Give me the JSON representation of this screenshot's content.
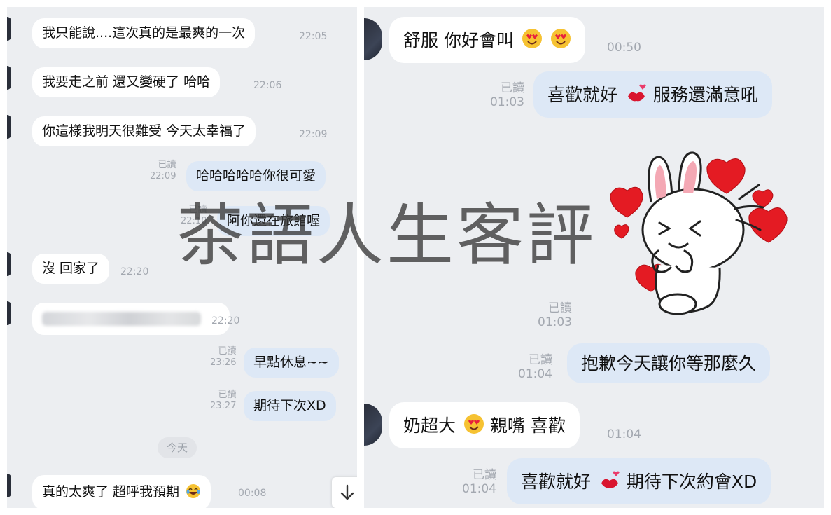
{
  "left_chat": {
    "messages": [
      {
        "text": "我只能說....這次真的是最爽的一次",
        "time": "22:05"
      },
      {
        "text": "我要走之前 還又變硬了 哈哈",
        "time": "22:06"
      },
      {
        "text": "你這樣我明天很難受 今天太幸福了",
        "time": "22:09"
      },
      {
        "text": "哈哈哈哈哈你很可愛",
        "read": "已讀",
        "time": "22:09"
      },
      {
        "text": "阿你還在旅館喔",
        "read": "已讀",
        "time": "22:10"
      },
      {
        "text": "沒 回家了",
        "time": "22:20"
      },
      {
        "text": "",
        "time": "22:20"
      },
      {
        "text": "早點休息~~",
        "read": "已讀",
        "time": "23:26"
      },
      {
        "text": "期待下次XD",
        "read": "已讀",
        "time": "23:27"
      },
      {
        "text": "真的太爽了 超呼我預期",
        "time": "00:08"
      }
    ],
    "day_separator": "今天",
    "scroll_icon": "arrow-down-icon"
  },
  "right_chat": {
    "messages": [
      {
        "text": "舒服 你好會叫",
        "time": "00:50"
      },
      {
        "text_a": "喜歡就好",
        "text_b": "服務還滿意吼",
        "read": "已讀",
        "time": "01:03"
      },
      {
        "sticker": "bunny-hearts-sticker",
        "read": "已讀",
        "time": "01:03"
      },
      {
        "text": "抱歉今天讓你等那麼久",
        "read": "已讀",
        "time": "01:04"
      },
      {
        "text_a": "奶超大",
        "text_b": "親嘴 喜歡",
        "time": "01:04"
      },
      {
        "text_a": "喜歡就好",
        "text_b": "期待下次約會XD",
        "read": "已讀",
        "time": "01:04"
      }
    ]
  },
  "watermark": "茶語人生客評",
  "colors": {
    "chat_background": "#eceef1",
    "received_bubble": "#ffffff",
    "sent_bubble": "#dde8f6",
    "meta_text": "#a3a8b0"
  }
}
